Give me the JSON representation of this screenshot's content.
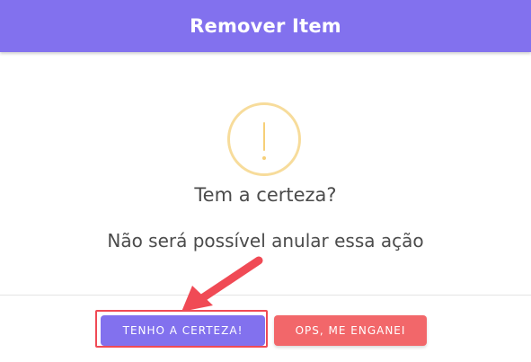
{
  "dialog": {
    "title": "Remover Item",
    "question": "Tem a certeza?",
    "message": "Não será possível anular essa ação",
    "icon": "warning-exclamation-icon"
  },
  "buttons": {
    "confirm_label": "TENHO A CERTEZA!",
    "cancel_label": "OPS, ME ENGANEI"
  },
  "annotation": {
    "type": "arrow-pointing-to-confirm-button",
    "color": "#f04a55"
  },
  "colors": {
    "header": "#8271ee",
    "confirm_button": "#8271ee",
    "cancel_button": "#f2676a",
    "warning_icon": "#f7dc9b",
    "text": "#4b4b4b"
  }
}
